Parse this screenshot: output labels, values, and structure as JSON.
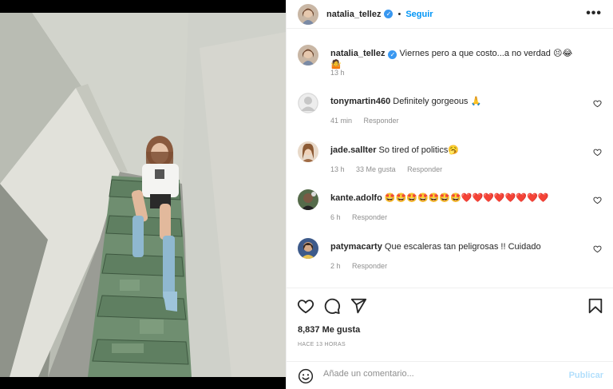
{
  "post_author": {
    "username": "natalia_tellez",
    "verified": true,
    "follow_label": "Seguir",
    "more_label": "•••"
  },
  "caption": {
    "username": "natalia_tellez",
    "text": "Viernes pero a que costo...a no verdad",
    "emojis": [
      "😣",
      "😂",
      "🤷"
    ],
    "time": "13 h"
  },
  "comments": [
    {
      "username": "tonymartin460",
      "text": "Definitely gorgeous",
      "emojis": [
        "🙏"
      ],
      "time": "41 min",
      "likes": "",
      "reply": "Responder"
    },
    {
      "username": "jade.sallter",
      "text": "So tired of politics",
      "emojis": [
        "🥱"
      ],
      "time": "13 h",
      "likes": "33 Me gusta",
      "reply": "Responder"
    },
    {
      "username": "kante.adolfo",
      "text": "",
      "emojis": [
        "🤩",
        "🤩",
        "🤩",
        "🤩",
        "🤩",
        "🤩",
        "🤩",
        "❤️",
        "❤️",
        "❤️",
        "❤️",
        "❤️",
        "❤️",
        "❤️",
        "❤️"
      ],
      "time": "6 h",
      "likes": "",
      "reply": "Responder"
    },
    {
      "username": "patymacarty",
      "text": "Que escaleras tan peligrosas !! Cuidado",
      "emojis": [],
      "time": "2 h",
      "likes": "",
      "reply": "Responder"
    }
  ],
  "likes_label": "8,837 Me gusta",
  "posted_ago": "HACE 13 HORAS",
  "comment_input": {
    "placeholder": "Añade un comentario...",
    "value": ""
  },
  "publish_label": "Publicar",
  "colors": {
    "link": "#0095f6",
    "verified": "#3897f0",
    "muted": "#8e8e8e",
    "publish_disabled": "#b2dffc"
  }
}
